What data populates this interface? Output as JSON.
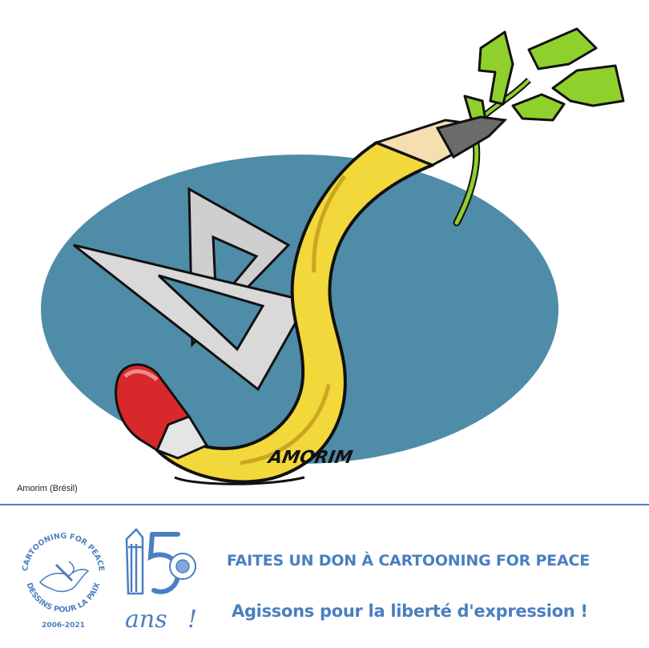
{
  "illustration": {
    "signature": "AMORIM",
    "credit": "Amorim (Brésil)"
  },
  "footer": {
    "logo_cfp": {
      "top_text": "CARTOONING FOR PEACE",
      "bottom_text": "DESSINS POUR LA PAIX",
      "years": "2006-2021"
    },
    "logo_anniversary": {
      "number": "15",
      "word": "ans",
      "mark": "!",
      "badge_text": "CARTOONING FOR PEACE"
    },
    "headline_1": "FAITES UN DON À CARTOONING FOR PEACE",
    "headline_2": "Agissons pour la liberté d'expression !"
  },
  "colors": {
    "ellipse": "#4f8ca8",
    "pencil": "#f2d83a",
    "eraser": "#d8282b",
    "leaves": "#8fd02c",
    "accent": "#4a7fc1"
  }
}
